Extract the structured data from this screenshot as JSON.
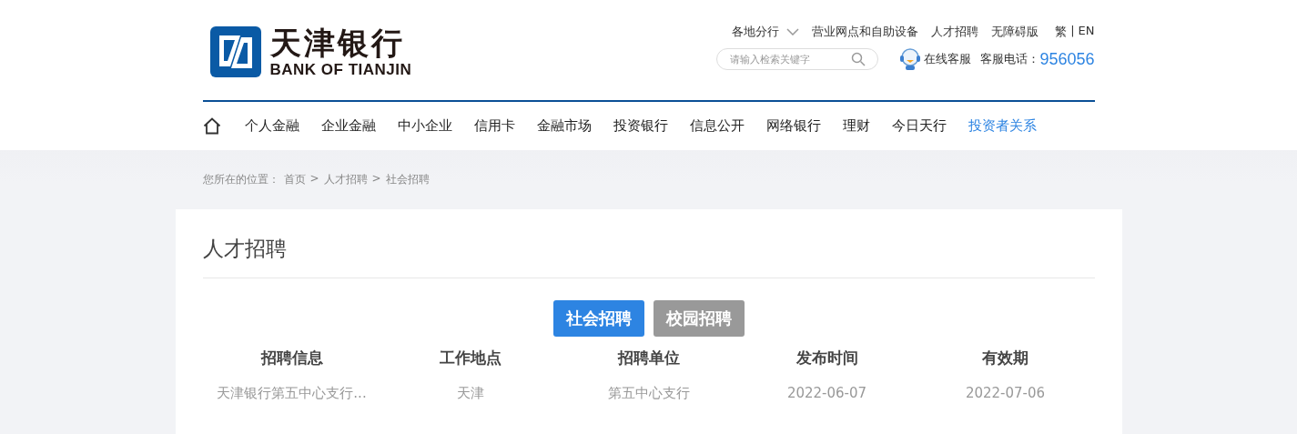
{
  "logo": {
    "name": "天津银行",
    "english": "BANK OF TIANJIN"
  },
  "top_links": [
    {
      "label": "各地分行",
      "dropdown": true
    },
    {
      "label": "营业网点和自助设备",
      "dropdown": false
    },
    {
      "label": "人才招聘",
      "dropdown": false
    },
    {
      "label": "无障碍版",
      "dropdown": false
    }
  ],
  "language": {
    "traditional": "繁",
    "separator": "|",
    "english": "EN"
  },
  "search": {
    "placeholder": "请输入检索关键字"
  },
  "service": {
    "online": "在线客服",
    "hotline_label": "客服电话：",
    "hotline": "956056"
  },
  "nav": [
    {
      "label": "个人金融",
      "selected": false
    },
    {
      "label": "企业金融",
      "selected": false
    },
    {
      "label": "中小企业",
      "selected": false
    },
    {
      "label": "信用卡",
      "selected": false
    },
    {
      "label": "金融市场",
      "selected": false
    },
    {
      "label": "投资银行",
      "selected": false
    },
    {
      "label": "信息公开",
      "selected": false
    },
    {
      "label": "网络银行",
      "selected": false
    },
    {
      "label": "理财",
      "selected": false
    },
    {
      "label": "今日天行",
      "selected": false
    },
    {
      "label": "投资者关系",
      "selected": true
    }
  ],
  "breadcrumb": {
    "label": "您所在的位置：",
    "items": [
      "首页",
      "人才招聘",
      "社会招聘"
    ],
    "separator": ">"
  },
  "page_title": "人才招聘",
  "tabs": [
    {
      "label": "社会招聘",
      "selected": true
    },
    {
      "label": "校园招聘",
      "selected": false
    }
  ],
  "table": {
    "columns": [
      "招聘信息",
      "工作地点",
      "招聘单位",
      "发布时间",
      "有效期"
    ],
    "rows": [
      [
        "天津银行第五中心支行...",
        "天津",
        "第五中心支行",
        "2022-06-07",
        "2022-07-06"
      ]
    ]
  }
}
